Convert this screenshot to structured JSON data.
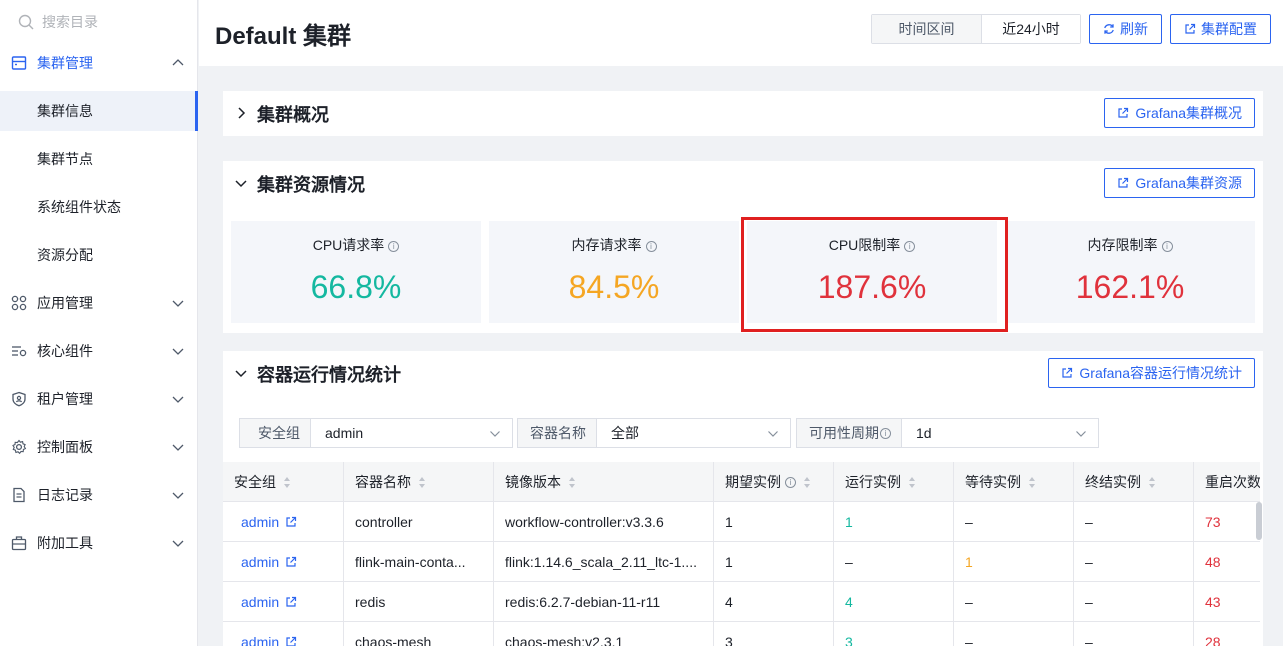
{
  "sidebar": {
    "search_placeholder": "搜索目录",
    "groups": [
      {
        "label": "集群管理",
        "icon": "cluster-icon"
      },
      {
        "label": "应用管理",
        "icon": "apps-icon"
      },
      {
        "label": "核心组件",
        "icon": "components-icon"
      },
      {
        "label": "租户管理",
        "icon": "tenant-shield-icon"
      },
      {
        "label": "控制面板",
        "icon": "gear-icon"
      },
      {
        "label": "日志记录",
        "icon": "log-document-icon"
      },
      {
        "label": "附加工具",
        "icon": "toolbox-icon"
      }
    ],
    "cluster_items": [
      "集群信息",
      "集群节点",
      "系统组件状态",
      "资源分配"
    ]
  },
  "header": {
    "title": "Default 集群",
    "time_label": "时间区间",
    "time_value": "近24小时",
    "refresh_label": "刷新",
    "config_label": "集群配置"
  },
  "overview": {
    "title": "集群概况",
    "grafana_label": "Grafana集群概况"
  },
  "resources": {
    "title": "集群资源情况",
    "grafana_label": "Grafana集群资源",
    "metrics": [
      {
        "label": "CPU请求率",
        "value": "66.8%",
        "color": "#14b8a0"
      },
      {
        "label": "内存请求率",
        "value": "84.5%",
        "color": "#f5a623"
      },
      {
        "label": "CPU限制率",
        "value": "187.6%",
        "color": "#e0323c"
      },
      {
        "label": "内存限制率",
        "value": "162.1%",
        "color": "#e0323c"
      }
    ]
  },
  "containers": {
    "title": "容器运行情况统计",
    "grafana_label": "Grafana容器运行情况统计",
    "filters": [
      {
        "label": "安全组",
        "value": "admin"
      },
      {
        "label": "容器名称",
        "value": "全部"
      },
      {
        "label": "可用性周期",
        "value": "1d"
      }
    ],
    "columns": [
      "安全组",
      "容器名称",
      "镜像版本",
      "期望实例",
      "运行实例",
      "等待实例",
      "终结实例",
      "重启次数"
    ],
    "rows": [
      {
        "group": "admin",
        "name": "controller",
        "image": "workflow-controller:v3.3.6",
        "desired": "1",
        "running": "1",
        "waiting": "–",
        "terminated": "–",
        "restarts": "73"
      },
      {
        "group": "admin",
        "name": "flink-main-conta...",
        "image": "flink:1.14.6_scala_2.11_ltc-1....",
        "desired": "1",
        "running": "–",
        "waiting": "1",
        "terminated": "–",
        "restarts": "48"
      },
      {
        "group": "admin",
        "name": "redis",
        "image": "redis:6.2.7-debian-11-r11",
        "desired": "4",
        "running": "4",
        "waiting": "–",
        "terminated": "–",
        "restarts": "43"
      },
      {
        "group": "admin",
        "name": "chaos-mesh",
        "image": "chaos-mesh:v2.3.1",
        "desired": "3",
        "running": "3",
        "waiting": "–",
        "terminated": "–",
        "restarts": "28"
      }
    ]
  },
  "colors": {
    "accent": "#2b64f0",
    "green": "#14b8a0",
    "orange": "#f5a623",
    "red": "#e0323c",
    "highlight_border": "#e02020"
  }
}
